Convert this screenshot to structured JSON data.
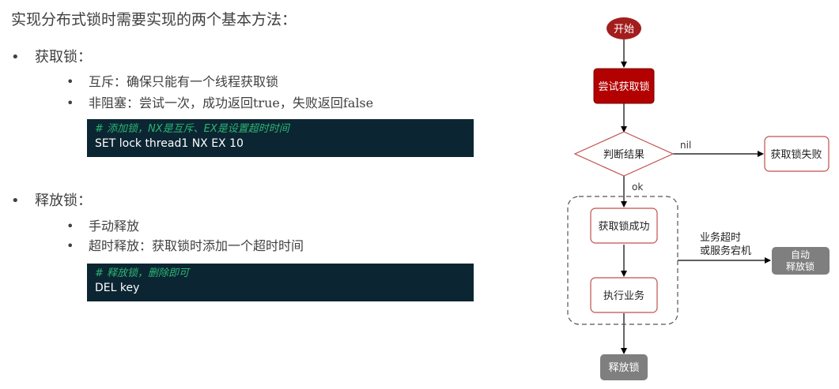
{
  "title": "实现分布式锁时需要实现的两个基本方法：",
  "sections": [
    {
      "heading": "获取锁：",
      "items": [
        "互斥：确保只能有一个线程获取锁",
        "非阻塞：尝试一次，成功返回true，失败返回false"
      ],
      "code_comment": "# 添加锁，NX是互斥、EX是设置超时时间",
      "code_line": "SET lock thread1 NX EX 10"
    },
    {
      "heading": "释放锁：",
      "items": [
        "手动释放",
        "超时释放：获取锁时添加一个超时时间"
      ],
      "code_comment": "# 释放锁，删除即可",
      "code_line": "DEL key"
    }
  ],
  "flowchart": {
    "start": "开始",
    "try_lock": "尝试获取锁",
    "decision": "判断结果",
    "nil_label": "nil",
    "fail": "获取锁失败",
    "ok_label": "ok",
    "success": "获取锁成功",
    "execute": "执行业务",
    "timeout_label_line1": "业务超时",
    "timeout_label_line2": "或服务宕机",
    "auto_release_line1": "自动",
    "auto_release_line2": "释放锁",
    "release": "释放锁",
    "colors": {
      "red_dark": "#a31d1d",
      "red_border": "#c0504d",
      "gray_box": "#7f7f7f",
      "code_bg": "#0c2532",
      "comment": "#2bb673"
    }
  }
}
